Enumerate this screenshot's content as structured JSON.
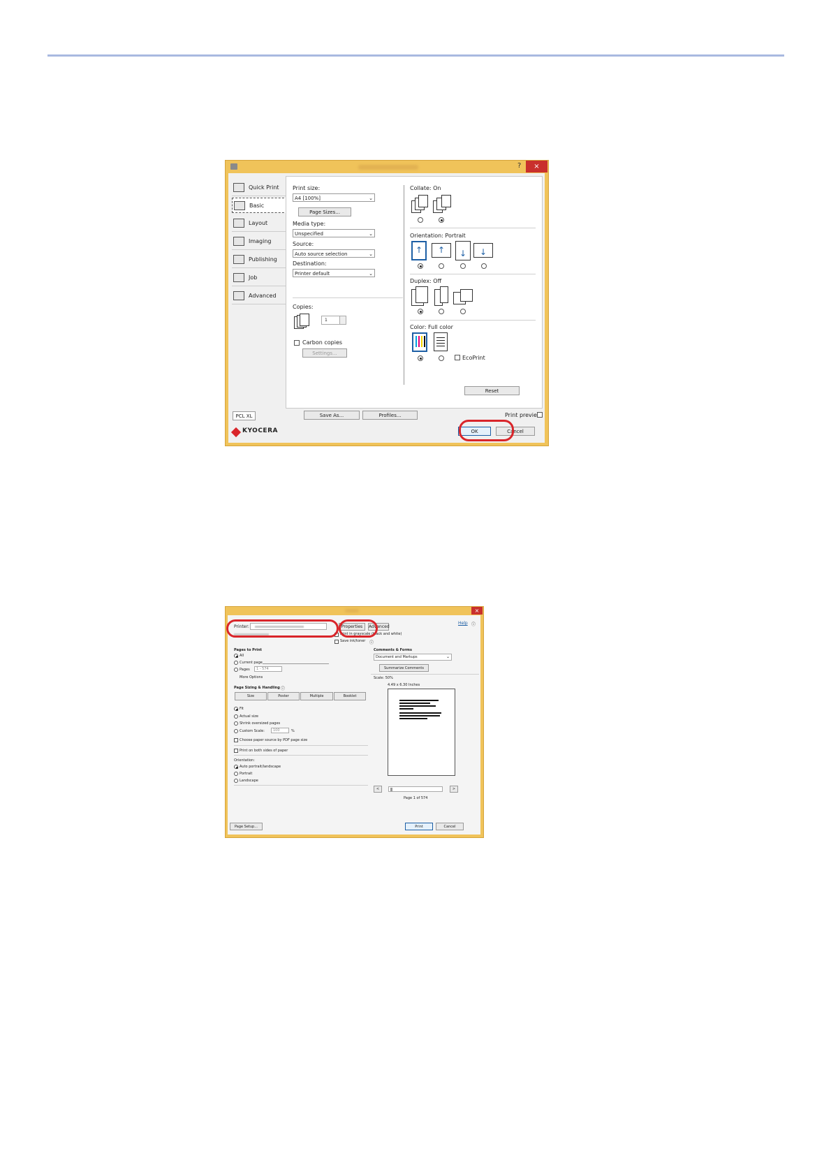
{
  "dialog1": {
    "help_glyph": "?",
    "close_glyph": "×",
    "sidebar": [
      {
        "label": "Quick Print",
        "icon": "quick-print-icon"
      },
      {
        "label": "Basic",
        "icon": "basic-icon"
      },
      {
        "label": "Layout",
        "icon": "layout-icon"
      },
      {
        "label": "Imaging",
        "icon": "imaging-icon"
      },
      {
        "label": "Publishing",
        "icon": "publishing-icon"
      },
      {
        "label": "Job",
        "icon": "job-icon"
      },
      {
        "label": "Advanced",
        "icon": "advanced-icon"
      }
    ],
    "print_size_label": "Print size:",
    "print_size_value": "A4 [100%]",
    "page_sizes_button": "Page Sizes...",
    "media_type_label": "Media type:",
    "media_type_value": "Unspecified",
    "source_label": "Source:",
    "source_value": "Auto source selection",
    "destination_label": "Destination:",
    "destination_value": "Printer default",
    "copies_label": "Copies:",
    "copies_value": "1",
    "carbon_copies_label": "Carbon copies",
    "settings_button": "Settings...",
    "collate_label": "Collate:  On",
    "orientation_label": "Orientation:  Portrait",
    "duplex_label": "Duplex:  Off",
    "color_label": "Color:  Full color",
    "ecoprint_label": "EcoPrint",
    "reset_button": "Reset",
    "pcl_button": "PCL XL",
    "save_as_button": "Save As...",
    "profiles_button": "Profiles...",
    "print_preview_label": "Print preview",
    "brand": "KYOCERA",
    "ok_button": "OK",
    "cancel_button": "Cancel",
    "arrow_up": "↑",
    "arrow_down": "↓",
    "dropdown_arrow": "⌄"
  },
  "dialog2": {
    "close_glyph": "×",
    "printer_label": "Printer:",
    "properties_button": "Properties",
    "advanced_button": "Advanced",
    "help_link": "Help",
    "info_glyph": "ⓘ",
    "grayscale_label": "Print in grayscale (black and white)",
    "save_ink_label": "Save ink/toner",
    "pages_to_print_label": "Pages to Print",
    "all_label": "All",
    "current_page_label": "Current page",
    "pages_label": "Pages",
    "pages_value": "1 - 574",
    "more_options_label": "More Options",
    "page_sizing_label": "Page Sizing & Handling",
    "size_button": "Size",
    "poster_button": "Poster",
    "multiple_button": "Multiple",
    "booklet_button": "Booklet",
    "fit_label": "Fit",
    "actual_size_label": "Actual size",
    "shrink_label": "Shrink oversized pages",
    "custom_scale_label": "Custom Scale:",
    "custom_scale_value": "100",
    "percent": "%",
    "choose_source_label": "Choose paper source by PDF page size",
    "both_sides_label": "Print on both sides of paper",
    "orientation_label": "Orientation:",
    "auto_orient_label": "Auto portrait/landscape",
    "portrait_label": "Portrait",
    "landscape_label": "Landscape",
    "comments_forms_label": "Comments & Forms",
    "comments_value": "Document and Markups",
    "summarize_button": "Summarize Comments",
    "scale_label": "Scale:  50%",
    "size_inches": "4.49 x 6.30 Inches",
    "prev_glyph": "<",
    "next_glyph": ">",
    "page_of": "Page 1 of 574",
    "page_setup_button": "Page Setup...",
    "print_button": "Print",
    "cancel_button": "Cancel"
  }
}
